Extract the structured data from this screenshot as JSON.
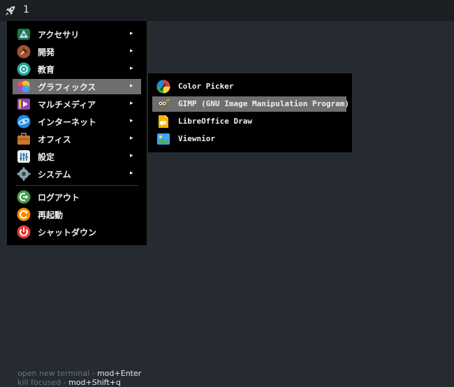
{
  "topbar": {
    "workspace": "1",
    "launcher_icon": "rocket-icon"
  },
  "menu": {
    "items": [
      {
        "label": "アクセサリ",
        "icon": "accessories-icon",
        "has_submenu": true
      },
      {
        "label": "開発",
        "icon": "development-icon",
        "has_submenu": true
      },
      {
        "label": "教育",
        "icon": "education-icon",
        "has_submenu": true
      },
      {
        "label": "グラフィックス",
        "icon": "graphics-icon",
        "has_submenu": true,
        "active": true
      },
      {
        "label": "マルチメディア",
        "icon": "multimedia-icon",
        "has_submenu": true
      },
      {
        "label": "インターネット",
        "icon": "internet-icon",
        "has_submenu": true
      },
      {
        "label": "オフィス",
        "icon": "office-icon",
        "has_submenu": true
      },
      {
        "label": "設定",
        "icon": "settings-icon",
        "has_submenu": true
      },
      {
        "label": "システム",
        "icon": "system-icon",
        "has_submenu": true
      }
    ],
    "arrow": "▸",
    "session": [
      {
        "label": "ログアウト",
        "icon": "logout-icon"
      },
      {
        "label": "再起動",
        "icon": "reboot-icon"
      },
      {
        "label": "シャットダウン",
        "icon": "shutdown-icon"
      }
    ]
  },
  "submenu": {
    "items": [
      {
        "label": "Color Picker",
        "icon": "color-picker-icon"
      },
      {
        "label": "GIMP (GNU Image Manipulation Program)",
        "icon": "gimp-icon",
        "active": true
      },
      {
        "label": "LibreOffice Draw",
        "icon": "libreoffice-draw-icon"
      },
      {
        "label": "Viewnior",
        "icon": "viewnior-icon"
      }
    ]
  },
  "hints": [
    {
      "desc": "open new terminal - ",
      "key": "mod+Enter"
    },
    {
      "desc": "kill focused - ",
      "key": "mod+Shift+q"
    }
  ],
  "colors": {
    "background": "#252b31",
    "menu": "#000000",
    "highlight": "#6e6e6e"
  }
}
